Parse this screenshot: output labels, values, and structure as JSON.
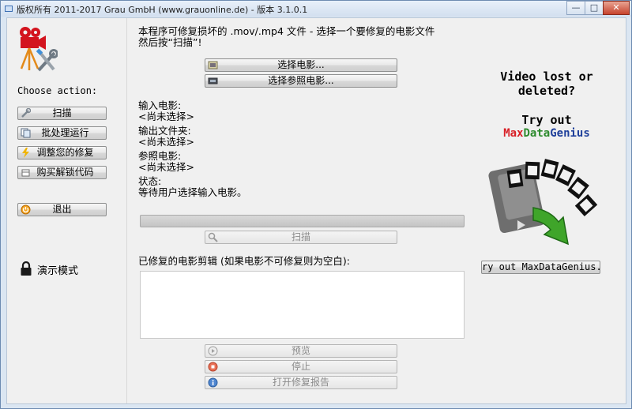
{
  "window": {
    "title": "版权所有 2011-2017 Grau GmbH (www.grauonline.de) - 版本 3.1.0.1",
    "controls": {
      "minimize": "—",
      "maximize": "□",
      "close": "✕"
    }
  },
  "sidebar": {
    "choose_action": "Choose action:",
    "buttons": [
      {
        "label": "扫描",
        "icon": "wrench-icon"
      },
      {
        "label": "批处理运行",
        "icon": "batch-icon"
      },
      {
        "label": "调整您的修复",
        "icon": "adjust-icon"
      },
      {
        "label": "购买解锁代码",
        "icon": "cart-icon"
      }
    ],
    "exit_label": "退出",
    "demo_mode": "演示模式"
  },
  "main": {
    "intro_line1": "本程序可修复损坏的 .mov/.mp4 文件 - 选择一个要修复的电影文件",
    "intro_line2": "然后按“扫描”!",
    "select_movie_button": "选择电影...",
    "select_reference_button": "选择参照电影...",
    "input_movie_label": "输入电影:",
    "input_movie_value": "<尚未选择>",
    "output_folder_label": "输出文件夹:",
    "output_folder_value": "<尚未选择>",
    "reference_movie_label": "参照电影:",
    "reference_movie_value": "<尚未选择>",
    "status_label": "状态:",
    "status_value": "等待用户选择输入电影。",
    "progress": 0,
    "scan_button": "扫描",
    "repaired_clips_label": "已修复的电影剪辑 (如果电影不可修复则为空白):",
    "preview_button": "预览",
    "stop_button": "停止",
    "open_report_button": "打开修复报告"
  },
  "promo": {
    "headline_line1": "Video lost or",
    "headline_line2": "deleted?",
    "try_out": "Try out",
    "brand_part1": "Max",
    "brand_part2": "Data",
    "brand_part3": "Genius",
    "button_label": "ry out MaxDataGenius..",
    "colors": {
      "brand_red": "#d81f26",
      "brand_green": "#2c8a2c",
      "brand_blue": "#1e3f9a",
      "arrow_green": "#3fa52a"
    }
  }
}
